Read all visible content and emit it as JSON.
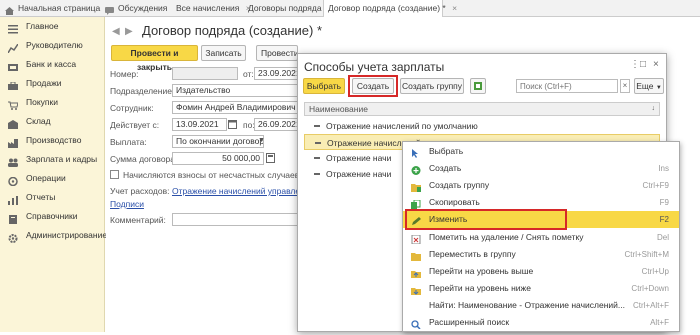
{
  "tabs": [
    {
      "label": "Начальная страница"
    },
    {
      "label": "Обсуждения"
    },
    {
      "label": "Все начисления"
    },
    {
      "label": "Договоры подряда"
    },
    {
      "label": "Договор подряда (создание) *"
    }
  ],
  "sidebar": {
    "items": [
      {
        "label": "Главное"
      },
      {
        "label": "Руководителю"
      },
      {
        "label": "Банк и касса"
      },
      {
        "label": "Продажи"
      },
      {
        "label": "Покупки"
      },
      {
        "label": "Склад"
      },
      {
        "label": "Производство"
      },
      {
        "label": "Зарплата и кадры"
      },
      {
        "label": "Операции"
      },
      {
        "label": "Отчеты"
      },
      {
        "label": "Справочники"
      },
      {
        "label": "Администрирование"
      }
    ]
  },
  "form": {
    "title": "Договор подряда (создание) *",
    "buttons": {
      "post_close": "Провести и закрыть",
      "save": "Записать",
      "post": "Провести",
      "print": "Печать"
    },
    "number_label": "Номер:",
    "number_value": "",
    "from_label": "от:",
    "from_value": "23.09.2021",
    "dept_label": "Подразделение:",
    "dept_value": "Издательство",
    "employee_label": "Сотрудник:",
    "employee_value": "Фомин Андрей Владимирович",
    "valid_label": "Действует с:",
    "valid_from": "13.09.2021",
    "valid_to_label": "по:",
    "valid_to": "26.09.2021",
    "payment_label": "Выплата:",
    "payment_value": "По окончании договора",
    "sum_label": "Сумма договора:",
    "sum_value": "50 000,00",
    "insurance_label": "Начисляются взносы от несчастных случаев",
    "accounting_label": "Учет расходов:",
    "accounting_link": "Отражение начислений управление",
    "signatures_link": "Подписи",
    "comment_label": "Комментарий:",
    "comment_value": ""
  },
  "dialog": {
    "title": "Способы учета зарплаты",
    "select_button": "Выбрать",
    "create_button": "Создать",
    "create_group_button": "Создать группу",
    "search_placeholder": "Поиск (Ctrl+F)",
    "more_button": "Еще",
    "column_header": "Наименование",
    "rows": [
      {
        "label": "Отражение начислений по умолчанию"
      },
      {
        "label": "Отражение начислений производство"
      },
      {
        "label": "Отражение начи"
      },
      {
        "label": "Отражение начи"
      }
    ]
  },
  "context_menu": {
    "items": [
      {
        "label": "Выбрать",
        "shortcut": ""
      },
      {
        "label": "Создать",
        "shortcut": "Ins"
      },
      {
        "label": "Создать группу",
        "shortcut": "Ctrl+F9"
      },
      {
        "label": "Скопировать",
        "shortcut": "F9"
      },
      {
        "label": "Изменить",
        "shortcut": "F2"
      },
      {
        "label": "Пометить на удаление / Снять пометку",
        "shortcut": "Del"
      },
      {
        "label": "Переместить в группу",
        "shortcut": "Ctrl+Shift+M"
      },
      {
        "label": "Перейти на уровень выше",
        "shortcut": "Ctrl+Up"
      },
      {
        "label": "Перейти на уровень ниже",
        "shortcut": "Ctrl+Down"
      },
      {
        "label": "Найти: Наименование - Отражение начислений...",
        "shortcut": "Ctrl+Alt+F"
      },
      {
        "label": "Расширенный поиск",
        "shortcut": "Alt+F"
      }
    ]
  },
  "colors": {
    "accent": "#f8d846",
    "highlight_box": "#d62828",
    "sidebar_bg": "#fbf5d8"
  }
}
